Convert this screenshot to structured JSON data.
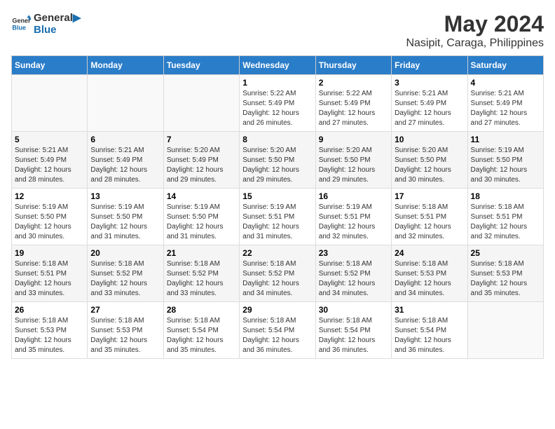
{
  "logo": {
    "line1": "General",
    "line2": "Blue"
  },
  "title": "May 2024",
  "subtitle": "Nasipit, Caraga, Philippines",
  "days_header": [
    "Sunday",
    "Monday",
    "Tuesday",
    "Wednesday",
    "Thursday",
    "Friday",
    "Saturday"
  ],
  "weeks": [
    [
      {
        "day": "",
        "info": ""
      },
      {
        "day": "",
        "info": ""
      },
      {
        "day": "",
        "info": ""
      },
      {
        "day": "1",
        "info": "Sunrise: 5:22 AM\nSunset: 5:49 PM\nDaylight: 12 hours and 26 minutes."
      },
      {
        "day": "2",
        "info": "Sunrise: 5:22 AM\nSunset: 5:49 PM\nDaylight: 12 hours and 27 minutes."
      },
      {
        "day": "3",
        "info": "Sunrise: 5:21 AM\nSunset: 5:49 PM\nDaylight: 12 hours and 27 minutes."
      },
      {
        "day": "4",
        "info": "Sunrise: 5:21 AM\nSunset: 5:49 PM\nDaylight: 12 hours and 27 minutes."
      }
    ],
    [
      {
        "day": "5",
        "info": "Sunrise: 5:21 AM\nSunset: 5:49 PM\nDaylight: 12 hours and 28 minutes."
      },
      {
        "day": "6",
        "info": "Sunrise: 5:21 AM\nSunset: 5:49 PM\nDaylight: 12 hours and 28 minutes."
      },
      {
        "day": "7",
        "info": "Sunrise: 5:20 AM\nSunset: 5:49 PM\nDaylight: 12 hours and 29 minutes."
      },
      {
        "day": "8",
        "info": "Sunrise: 5:20 AM\nSunset: 5:50 PM\nDaylight: 12 hours and 29 minutes."
      },
      {
        "day": "9",
        "info": "Sunrise: 5:20 AM\nSunset: 5:50 PM\nDaylight: 12 hours and 29 minutes."
      },
      {
        "day": "10",
        "info": "Sunrise: 5:20 AM\nSunset: 5:50 PM\nDaylight: 12 hours and 30 minutes."
      },
      {
        "day": "11",
        "info": "Sunrise: 5:19 AM\nSunset: 5:50 PM\nDaylight: 12 hours and 30 minutes."
      }
    ],
    [
      {
        "day": "12",
        "info": "Sunrise: 5:19 AM\nSunset: 5:50 PM\nDaylight: 12 hours and 30 minutes."
      },
      {
        "day": "13",
        "info": "Sunrise: 5:19 AM\nSunset: 5:50 PM\nDaylight: 12 hours and 31 minutes."
      },
      {
        "day": "14",
        "info": "Sunrise: 5:19 AM\nSunset: 5:50 PM\nDaylight: 12 hours and 31 minutes."
      },
      {
        "day": "15",
        "info": "Sunrise: 5:19 AM\nSunset: 5:51 PM\nDaylight: 12 hours and 31 minutes."
      },
      {
        "day": "16",
        "info": "Sunrise: 5:19 AM\nSunset: 5:51 PM\nDaylight: 12 hours and 32 minutes."
      },
      {
        "day": "17",
        "info": "Sunrise: 5:18 AM\nSunset: 5:51 PM\nDaylight: 12 hours and 32 minutes."
      },
      {
        "day": "18",
        "info": "Sunrise: 5:18 AM\nSunset: 5:51 PM\nDaylight: 12 hours and 32 minutes."
      }
    ],
    [
      {
        "day": "19",
        "info": "Sunrise: 5:18 AM\nSunset: 5:51 PM\nDaylight: 12 hours and 33 minutes."
      },
      {
        "day": "20",
        "info": "Sunrise: 5:18 AM\nSunset: 5:52 PM\nDaylight: 12 hours and 33 minutes."
      },
      {
        "day": "21",
        "info": "Sunrise: 5:18 AM\nSunset: 5:52 PM\nDaylight: 12 hours and 33 minutes."
      },
      {
        "day": "22",
        "info": "Sunrise: 5:18 AM\nSunset: 5:52 PM\nDaylight: 12 hours and 34 minutes."
      },
      {
        "day": "23",
        "info": "Sunrise: 5:18 AM\nSunset: 5:52 PM\nDaylight: 12 hours and 34 minutes."
      },
      {
        "day": "24",
        "info": "Sunrise: 5:18 AM\nSunset: 5:53 PM\nDaylight: 12 hours and 34 minutes."
      },
      {
        "day": "25",
        "info": "Sunrise: 5:18 AM\nSunset: 5:53 PM\nDaylight: 12 hours and 35 minutes."
      }
    ],
    [
      {
        "day": "26",
        "info": "Sunrise: 5:18 AM\nSunset: 5:53 PM\nDaylight: 12 hours and 35 minutes."
      },
      {
        "day": "27",
        "info": "Sunrise: 5:18 AM\nSunset: 5:53 PM\nDaylight: 12 hours and 35 minutes."
      },
      {
        "day": "28",
        "info": "Sunrise: 5:18 AM\nSunset: 5:54 PM\nDaylight: 12 hours and 35 minutes."
      },
      {
        "day": "29",
        "info": "Sunrise: 5:18 AM\nSunset: 5:54 PM\nDaylight: 12 hours and 36 minutes."
      },
      {
        "day": "30",
        "info": "Sunrise: 5:18 AM\nSunset: 5:54 PM\nDaylight: 12 hours and 36 minutes."
      },
      {
        "day": "31",
        "info": "Sunrise: 5:18 AM\nSunset: 5:54 PM\nDaylight: 12 hours and 36 minutes."
      },
      {
        "day": "",
        "info": ""
      }
    ]
  ]
}
